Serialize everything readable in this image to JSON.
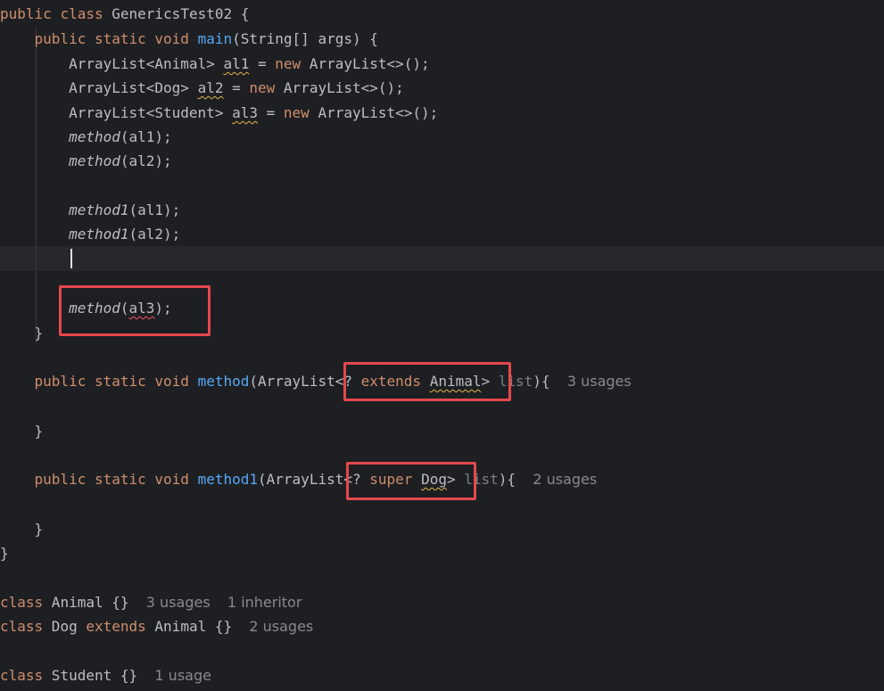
{
  "colors": {
    "background": "#1e1f22",
    "keyword": "#cf8e6d",
    "method": "#56a8f5",
    "text": "#bcbec4",
    "hint": "#868a91",
    "annotation_box": "#e5484d"
  },
  "code": {
    "l1": {
      "public": "public",
      "class": "class",
      "name": "GenericsTest02",
      "brace": " {"
    },
    "l2": {
      "public": "public",
      "static": "static",
      "void": "void",
      "main": "main",
      "rest": "(String[] args) {"
    },
    "l3": {
      "type": "ArrayList<Animal> ",
      "var": "al1",
      "eq": " = ",
      "new": "new",
      "rest": " ArrayList<>();"
    },
    "l4": {
      "type": "ArrayList<Dog> ",
      "var": "al2",
      "eq": " = ",
      "new": "new",
      "rest": " ArrayList<>();"
    },
    "l5": {
      "type": "ArrayList<Student> ",
      "var": "al3",
      "eq": " = ",
      "new": "new",
      "rest": " ArrayList<>();"
    },
    "l6": {
      "call": "method",
      "rest": "(al1);"
    },
    "l7": {
      "call": "method",
      "rest": "(al2);"
    },
    "l8": {
      "call": "method1",
      "rest": "(al1);"
    },
    "l9": {
      "call": "method1",
      "rest": "(al2);"
    },
    "l10": {
      "call": "method",
      "open": "(",
      "arg": "al3",
      "rest": ");"
    },
    "close_main": "}",
    "m1": {
      "public": "public",
      "static": "static",
      "void": "void",
      "name": "method",
      "pre": "(ArrayList",
      "lt": "<? ",
      "extends": "extends",
      "bound": "Animal",
      "gt": ">",
      "param": " list",
      "post": "){",
      "usages": "3 usages"
    },
    "close_m1": "}",
    "m2": {
      "public": "public",
      "static": "static",
      "void": "void",
      "name": "method1",
      "pre": "(ArrayList",
      "lt": "<? ",
      "super": "super",
      "bound": "Dog",
      "gt": ">",
      "param": " list",
      "post": "){",
      "usages": "2 usages"
    },
    "close_m2": "}",
    "close_class": "}",
    "c1": {
      "class": "class",
      "rest": " Animal {}",
      "usages": "3 usages",
      "inheritors": "1 inheritor"
    },
    "c2": {
      "class": "class",
      "mid": " Dog ",
      "extends": "extends",
      "rest": " Animal {}",
      "usages": "2 usages"
    },
    "c3": {
      "class": "class",
      "rest": " Student {}",
      "usages": "1 usage"
    }
  }
}
